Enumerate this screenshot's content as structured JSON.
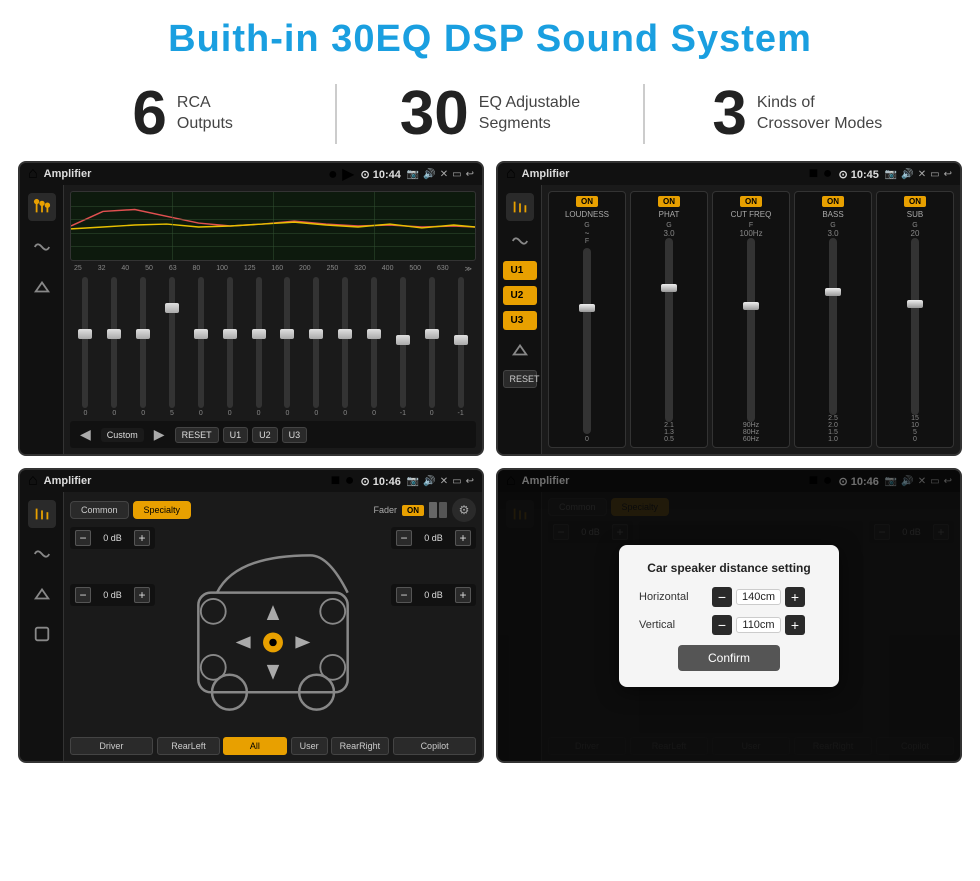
{
  "header": {
    "title": "Buith-in 30EQ DSP Sound System"
  },
  "stats": [
    {
      "number": "6",
      "label": "RCA\nOutputs"
    },
    {
      "number": "30",
      "label": "EQ Adjustable\nSegments"
    },
    {
      "number": "3",
      "label": "Kinds of\nCrossover Modes"
    }
  ],
  "screens": [
    {
      "id": "screen1",
      "title": "Amplifier",
      "time": "10:44",
      "type": "eq"
    },
    {
      "id": "screen2",
      "title": "Amplifier",
      "time": "10:45",
      "type": "amp"
    },
    {
      "id": "screen3",
      "title": "Amplifier",
      "time": "10:46",
      "type": "cross"
    },
    {
      "id": "screen4",
      "title": "Amplifier",
      "time": "10:46",
      "type": "dialog"
    }
  ],
  "eq": {
    "freqs": [
      "25",
      "32",
      "40",
      "50",
      "63",
      "80",
      "100",
      "125",
      "160",
      "200",
      "250",
      "320",
      "400",
      "500",
      "630"
    ],
    "values": [
      "0",
      "0",
      "0",
      "5",
      "0",
      "0",
      "0",
      "0",
      "0",
      "0",
      "0",
      "-1",
      "0",
      "-1"
    ],
    "preset": "Custom",
    "buttons": [
      "RESET",
      "U1",
      "U2",
      "U3"
    ]
  },
  "amp": {
    "units": [
      "U1",
      "U2",
      "U3"
    ],
    "modules": [
      {
        "name": "LOUDNESS",
        "on": true
      },
      {
        "name": "PHAT",
        "on": true
      },
      {
        "name": "CUT FREQ",
        "on": true
      },
      {
        "name": "BASS",
        "on": true
      },
      {
        "name": "SUB",
        "on": true
      }
    ]
  },
  "cross": {
    "tabs": [
      "Common",
      "Specialty"
    ],
    "activeTab": "Specialty",
    "fader": "Fader",
    "faderOn": "ON",
    "leftControls": [
      "0 dB",
      "0 dB"
    ],
    "rightControls": [
      "0 dB",
      "0 dB"
    ],
    "bottomButtons": [
      "Driver",
      "RearLeft",
      "All",
      "User",
      "RearRight",
      "Copilot"
    ]
  },
  "dialog": {
    "title": "Car speaker distance setting",
    "horizontal": {
      "label": "Horizontal",
      "value": "140cm"
    },
    "vertical": {
      "label": "Vertical",
      "value": "110cm"
    },
    "confirmButton": "Confirm",
    "dbLeft": "0 dB",
    "dbRight": "0 dB"
  }
}
